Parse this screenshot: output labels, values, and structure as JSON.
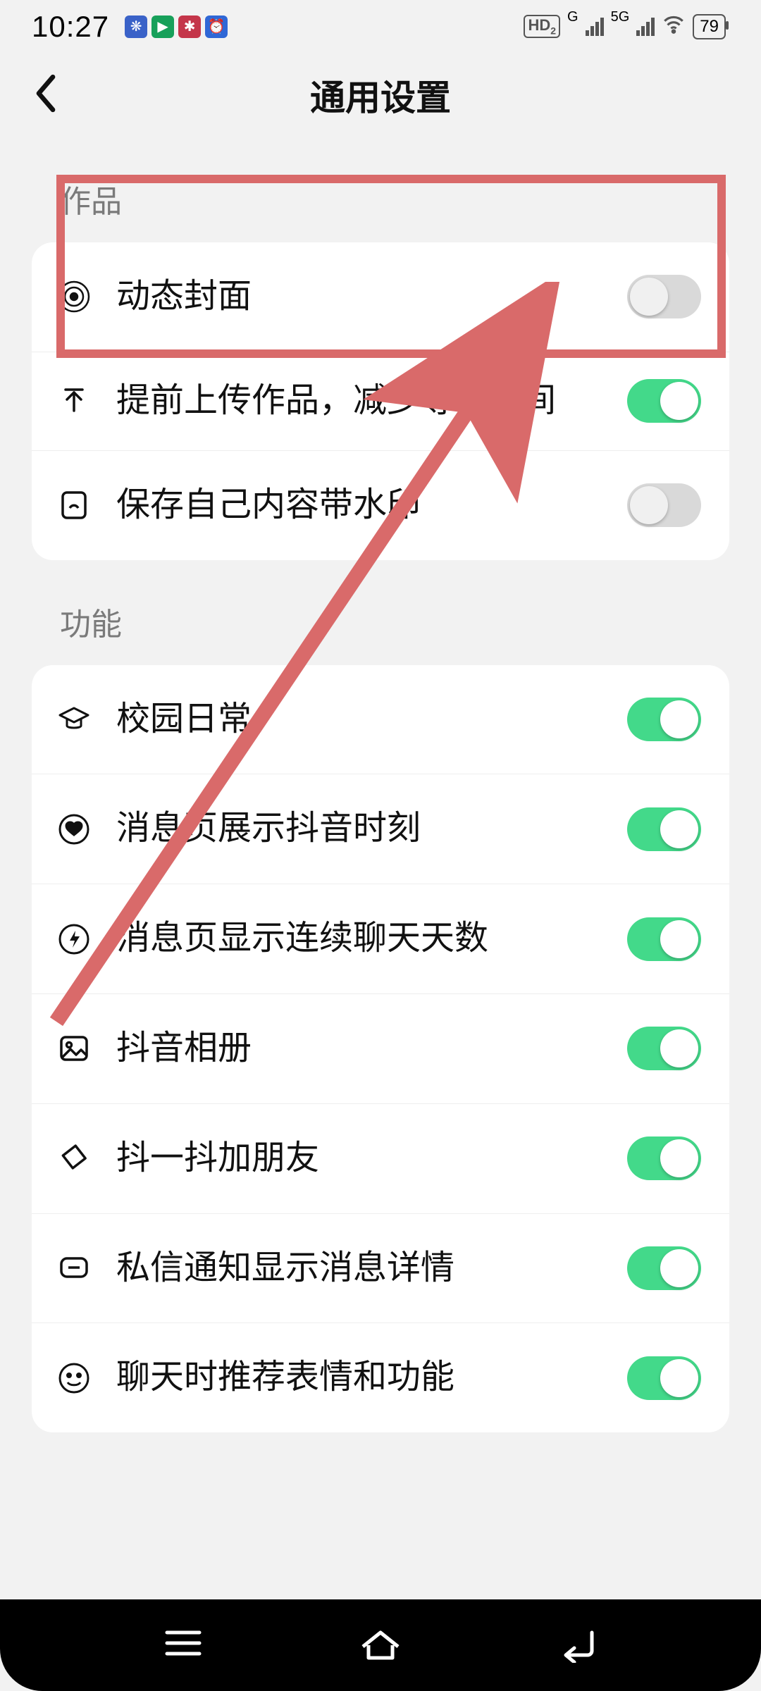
{
  "status": {
    "time": "10:27",
    "battery": "79"
  },
  "header": {
    "title": "通用设置"
  },
  "sections": {
    "works": {
      "label": "作品",
      "items": [
        {
          "icon": "record",
          "label": "动态封面",
          "on": false
        },
        {
          "icon": "upload",
          "label": "提前上传作品，减少等待时间",
          "on": true
        },
        {
          "icon": "watermark",
          "label": "保存自己内容带水印",
          "on": false
        }
      ]
    },
    "features": {
      "label": "功能",
      "items": [
        {
          "icon": "grad",
          "label": "校园日常",
          "on": true
        },
        {
          "icon": "heart",
          "label": "消息页展示抖音时刻",
          "on": true
        },
        {
          "icon": "bolt",
          "label": "消息页显示连续聊天天数",
          "on": true
        },
        {
          "icon": "album",
          "label": "抖音相册",
          "on": true
        },
        {
          "icon": "shake",
          "label": "抖一抖加朋友",
          "on": true
        },
        {
          "icon": "bubble",
          "label": "私信通知显示消息详情",
          "on": true
        },
        {
          "icon": "emoji",
          "label": "聊天时推荐表情和功能",
          "on": true
        }
      ]
    }
  },
  "colors": {
    "accent": "#43d98a",
    "toggle_off": "#d9d9d9",
    "highlight": "#d96a6a"
  }
}
